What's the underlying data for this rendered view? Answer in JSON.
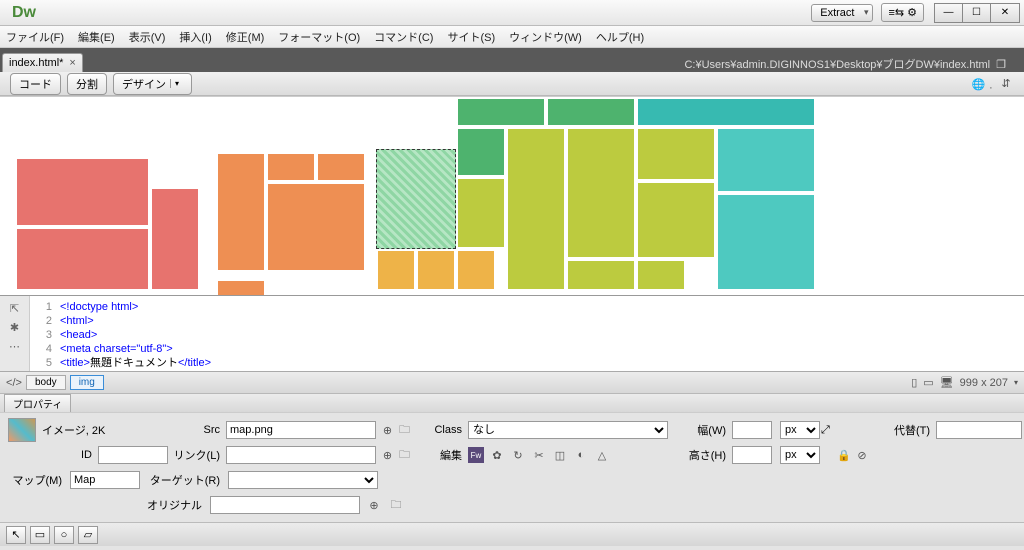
{
  "app": {
    "logo": "Dw",
    "extract": "Extract"
  },
  "menu": [
    "ファイル(F)",
    "編集(E)",
    "表示(V)",
    "挿入(I)",
    "修正(M)",
    "フォーマット(O)",
    "コマンド(C)",
    "サイト(S)",
    "ウィンドウ(W)",
    "ヘルプ(H)"
  ],
  "tab": {
    "name": "index.html*"
  },
  "path": "C:¥Users¥admin.DIGINNOS1¥Desktop¥ブログDW¥index.html",
  "view": {
    "code": "コード",
    "split": "分割",
    "design": "デザイン"
  },
  "code": {
    "lines": [
      "1",
      "2",
      "3",
      "4",
      "5"
    ],
    "l1": "<!doctype html>",
    "l2": "<html>",
    "l3": "<head>",
    "l4": "<meta charset=\"utf-8\">",
    "l5a": "<title>",
    "l5b": "無題ドキュメント",
    "l5c": "</title>"
  },
  "tagpath": {
    "body": "body",
    "img": "img"
  },
  "status": {
    "dims": "999 x 207"
  },
  "props_tab": "プロパティ",
  "props": {
    "image_label": "イメージ, 2K",
    "id_label": "ID",
    "src_label": "Src",
    "src_val": "map.png",
    "link_label": "リンク(L)",
    "class_label": "Class",
    "class_val": "なし",
    "edit_label": "編集",
    "w_label": "幅(W)",
    "h_label": "高さ(H)",
    "px": "px",
    "alt_label": "代替(T)",
    "map_label": "マップ(M)",
    "map_val": "Map",
    "target_label": "ターゲット(R)",
    "original_label": "オリジナル"
  }
}
